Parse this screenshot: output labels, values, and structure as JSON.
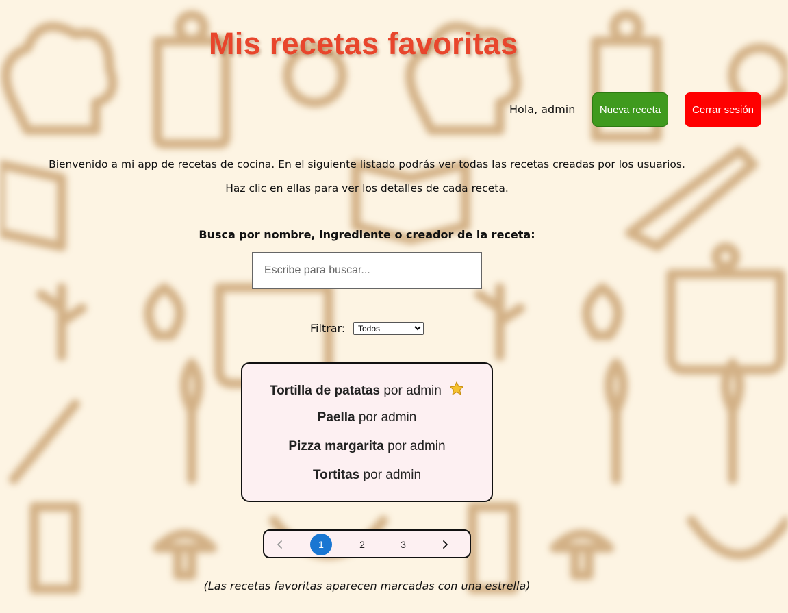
{
  "header": {
    "title": "Mis recetas favoritas",
    "greeting": "Hola, admin",
    "new_recipe_label": "Nueva receta",
    "logout_label": "Cerrar sesión"
  },
  "intro": {
    "line1": "Bienvenido a mi app de recetas de cocina. En el siguiente listado podrás ver todas las recetas creadas por los usuarios.",
    "line2": "Haz clic en ellas para ver los detalles de cada receta."
  },
  "search": {
    "label": "Busca por nombre, ingrediente o creador de la receta:",
    "placeholder": "Escribe para buscar...",
    "value": ""
  },
  "filter": {
    "label": "Filtrar:",
    "selected": "Todos"
  },
  "recipes": [
    {
      "name": "Tortilla de patatas",
      "by": "por admin",
      "favorite": true
    },
    {
      "name": "Paella",
      "by": "por admin",
      "favorite": false
    },
    {
      "name": "Pizza margarita",
      "by": "por admin",
      "favorite": false
    },
    {
      "name": "Tortitas",
      "by": "por admin",
      "favorite": false
    }
  ],
  "pagination": {
    "prev_icon": "chevron-left-icon",
    "next_icon": "chevron-right-icon",
    "pages": [
      "1",
      "2",
      "3"
    ],
    "current": "1"
  },
  "footnote": "(Las recetas favoritas aparecen marcadas con una estrella)",
  "colors": {
    "title": "#e8452c",
    "new_button": "#3f9a1e",
    "logout_button": "#ff0000",
    "active_page": "#1a76d2",
    "background": "#fdf4e3",
    "recipe_box": "#fdf0f2"
  }
}
